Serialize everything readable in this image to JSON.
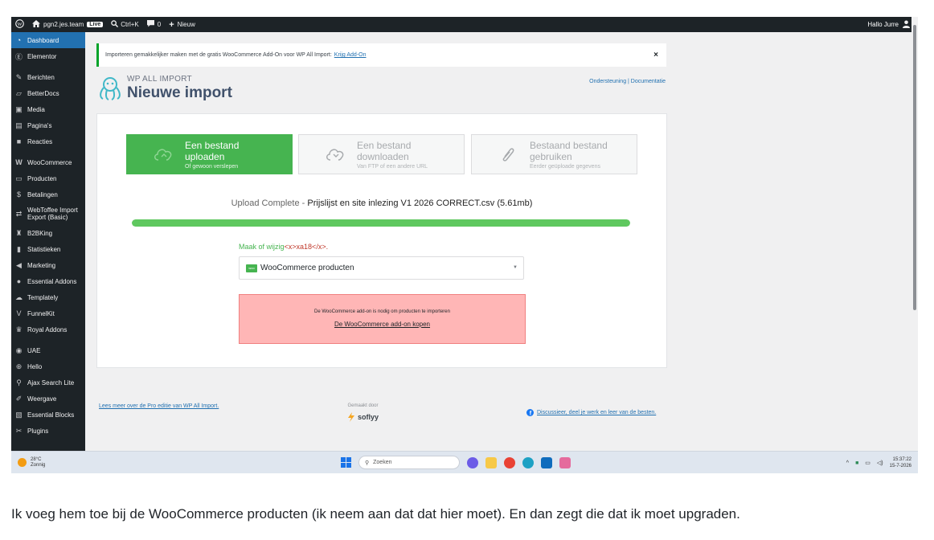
{
  "admin_bar": {
    "site_name": "pgn2.jes.team",
    "live_badge": "Live",
    "search_shortcut": "Ctrl+K",
    "comments_count": "0",
    "new_label": "Nieuw",
    "greeting": "Hallo Jurre",
    "icons": [
      "wordpress-icon",
      "home-icon",
      "search-icon",
      "comment-icon",
      "plus-icon",
      "user-icon"
    ]
  },
  "sidebar": {
    "items": [
      {
        "label": "Dashboard",
        "icon": "dashboard-icon",
        "active": true
      },
      {
        "label": "Elementor",
        "icon": "elementor-icon"
      },
      {
        "label": "Berichten",
        "icon": "pin-icon"
      },
      {
        "label": "BetterDocs",
        "icon": "docs-icon"
      },
      {
        "label": "Media",
        "icon": "media-icon"
      },
      {
        "label": "Pagina's",
        "icon": "page-icon"
      },
      {
        "label": "Reacties",
        "icon": "comment-icon"
      },
      {
        "label": "WooCommerce",
        "icon": "woocommerce-icon"
      },
      {
        "label": "Producten",
        "icon": "products-icon"
      },
      {
        "label": "Betalingen",
        "icon": "payments-icon"
      },
      {
        "label": "WebToffee Import Export (Basic)",
        "icon": "import-export-icon"
      },
      {
        "label": "B2BKing",
        "icon": "b2bking-icon"
      },
      {
        "label": "Statistieken",
        "icon": "stats-icon"
      },
      {
        "label": "Marketing",
        "icon": "megaphone-icon"
      },
      {
        "label": "Essential Addons",
        "icon": "essential-addons-icon"
      },
      {
        "label": "Templately",
        "icon": "templately-icon"
      },
      {
        "label": "FunnelKit",
        "icon": "funnelkit-icon"
      },
      {
        "label": "Royal Addons",
        "icon": "crown-icon"
      },
      {
        "label": "UAE",
        "icon": "uae-icon"
      },
      {
        "label": "Hello",
        "icon": "hello-icon"
      },
      {
        "label": "Ajax Search Lite",
        "icon": "search-icon"
      },
      {
        "label": "Weergave",
        "icon": "brush-icon"
      },
      {
        "label": "Essential Blocks",
        "icon": "blocks-icon"
      },
      {
        "label": "Plugins",
        "icon": "plugin-icon"
      }
    ]
  },
  "notice": {
    "text": "Importeren gemakkelijker maken met de gratis WooCommerce Add-On voor WP All Import:",
    "link": "Krijg Add-On",
    "close": "×"
  },
  "header": {
    "brand_small": "WP ALL IMPORT",
    "title": "Nieuwe import",
    "links": "Ondersteuning | Documentatie"
  },
  "options": [
    {
      "label": "Een bestand uploaden",
      "sub": "Of gewoon verslepen",
      "icon": "upload-cloud-icon",
      "active": true
    },
    {
      "label": "Een bestand downloaden",
      "sub": "Van FTP of een andere URL",
      "icon": "download-cloud-icon",
      "active": false
    },
    {
      "label": "Bestaand bestand gebruiken",
      "sub": "Eerder geüploade gegevens",
      "icon": "paperclip-icon",
      "active": false
    }
  ],
  "upload": {
    "status_label": "Upload Complete",
    "separator": " - ",
    "filename": "Prijslijst en site inlezing V1 2026 CORRECT.csv (5.61mb)",
    "progress": 1.0
  },
  "choose": {
    "label": "Maak of wijzig",
    "code": "<x>xa18</x>.",
    "selected": "WooCommerce producten",
    "badge": "woo"
  },
  "warning": {
    "text": "De WooCommerce add-on is nodig om producten te importeren",
    "link": "De WooCommerce add-on kopen"
  },
  "footer": {
    "pro_link": "Lees meer over de Pro editie van WP All Import.",
    "made_by": "Gemaakt door",
    "company": "soflyy",
    "community": "Discussieer, deel je werk en leer van de besten."
  },
  "taskbar": {
    "temperature": "28°C",
    "weather": "Zonnig",
    "search_placeholder": "Zoeken",
    "time": "15:37:22",
    "date": "15-7-2026"
  },
  "caption": "Ik voeg hem toe bij de WooCommerce producten (ik neem aan dat dat hier moet). En dan zegt die dat ik moet upgraden.",
  "colors": {
    "admin_dark": "#1d2327",
    "wp_blue": "#2271b1",
    "green": "#46b450",
    "warning_bg": "#ffb6b6"
  }
}
